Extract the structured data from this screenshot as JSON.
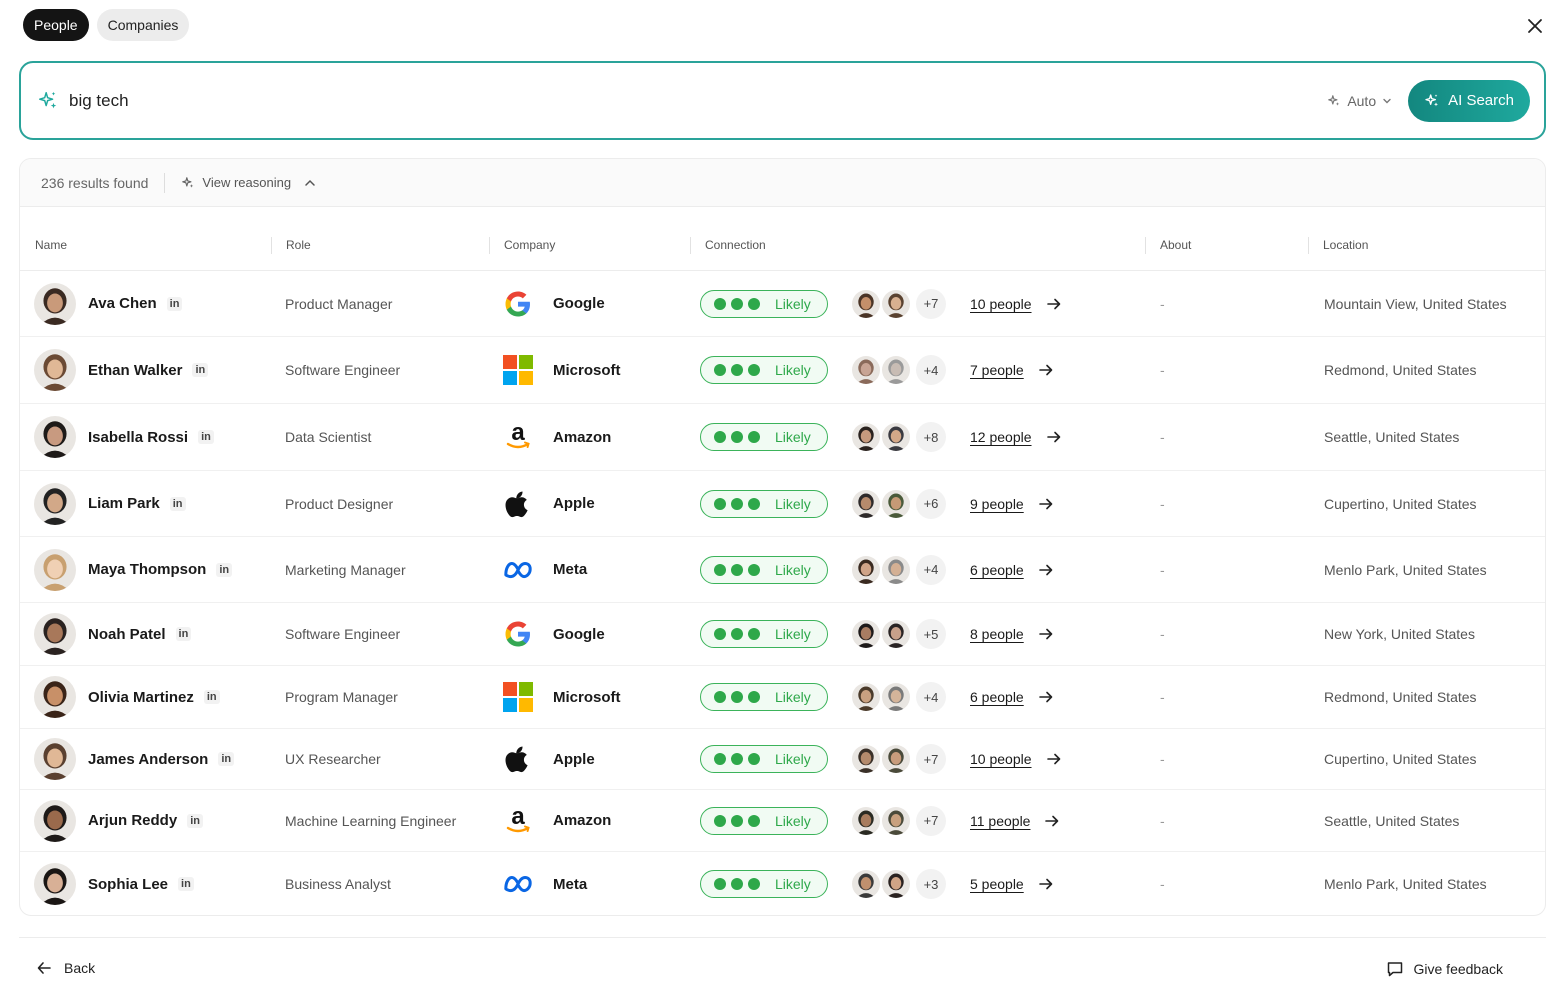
{
  "tabs": [
    {
      "label": "People",
      "active": true
    },
    {
      "label": "Companies",
      "active": false
    }
  ],
  "search": {
    "value": "big tech",
    "mode_label": "Auto",
    "button_label": "AI Search",
    "accent_color": "#2aa39a"
  },
  "results": {
    "count_label": "236 results found",
    "reasoning_label": "View reasoning"
  },
  "columns": [
    "Name",
    "Role",
    "Company",
    "Connection",
    "About",
    "Location"
  ],
  "rows": [
    {
      "name": "Ava Chen",
      "role": "Product Manager",
      "company": "Google",
      "logo": "google",
      "connection": "Likely",
      "plus": "+7",
      "people": "10 people",
      "about": "-",
      "location": "Mountain View, United States",
      "av": [
        "#3a2a22",
        "#c99a7a"
      ],
      "m1": [
        "#4a3426",
        "#c48f6a"
      ],
      "m2": [
        "#5a4230",
        "#d8b090"
      ]
    },
    {
      "name": "Ethan Walker",
      "role": "Software Engineer",
      "company": "Microsoft",
      "logo": "microsoft",
      "connection": "Likely",
      "plus": "+4",
      "people": "7 people",
      "about": "-",
      "location": "Redmond, United States",
      "av": [
        "#6b4a34",
        "#e0b896"
      ],
      "m1": [
        "#8a6a5a",
        "#c8a494"
      ],
      "m2": [
        "#9a9a9a",
        "#c8bcb4"
      ]
    },
    {
      "name": "Isabella Rossi",
      "role": "Data Scientist",
      "company": "Amazon",
      "logo": "amazon",
      "connection": "Likely",
      "plus": "+8",
      "people": "12 people",
      "about": "-",
      "location": "Seattle, United States",
      "av": [
        "#1e1a18",
        "#c89a80"
      ],
      "m1": [
        "#2a221e",
        "#c69a7e"
      ],
      "m2": [
        "#3a3a40",
        "#d4a888"
      ]
    },
    {
      "name": "Liam Park",
      "role": "Product Designer",
      "company": "Apple",
      "logo": "apple",
      "connection": "Likely",
      "plus": "+6",
      "people": "9 people",
      "about": "-",
      "location": "Cupertino, United States",
      "av": [
        "#222",
        "#d2a888"
      ],
      "m1": [
        "#2e2a2a",
        "#b68a6c"
      ],
      "m2": [
        "#4a5a3a",
        "#c69a76"
      ]
    },
    {
      "name": "Maya Thompson",
      "role": "Marketing Manager",
      "company": "Meta",
      "logo": "meta",
      "connection": "Likely",
      "plus": "+4",
      "people": "6 people",
      "about": "-",
      "location": "Menlo Park, United States",
      "av": [
        "#c8a070",
        "#f0d0b4"
      ],
      "m1": [
        "#3a2a20",
        "#d0a488"
      ],
      "m2": [
        "#8a8a8a",
        "#d4b094"
      ]
    },
    {
      "name": "Noah Patel",
      "role": "Software Engineer",
      "company": "Google",
      "logo": "google",
      "connection": "Likely",
      "plus": "+5",
      "people": "8 people",
      "about": "-",
      "location": "New York, United States",
      "av": [
        "#2a2220",
        "#a8785a"
      ],
      "m1": [
        "#1e1a1a",
        "#a87c62"
      ],
      "m2": [
        "#2a2424",
        "#c8a08a"
      ]
    },
    {
      "name": "Olivia Martinez",
      "role": "Program Manager",
      "company": "Microsoft",
      "logo": "microsoft",
      "connection": "Likely",
      "plus": "+4",
      "people": "6 people",
      "about": "-",
      "location": "Redmond, United States",
      "av": [
        "#3a2418",
        "#c89068"
      ],
      "m1": [
        "#4a3a2a",
        "#c8a080"
      ],
      "m2": [
        "#7a7a7a",
        "#d4b49a"
      ]
    },
    {
      "name": "James Anderson",
      "role": "UX Researcher",
      "company": "Apple",
      "logo": "apple",
      "connection": "Likely",
      "plus": "+7",
      "people": "10 people",
      "about": "-",
      "location": "Cupertino, United States",
      "av": [
        "#5a4030",
        "#e0b896"
      ],
      "m1": [
        "#3a3028",
        "#b48a6c"
      ],
      "m2": [
        "#4a4a3a",
        "#c89c7c"
      ]
    },
    {
      "name": "Arjun Reddy",
      "role": "Machine Learning Engineer",
      "company": "Amazon",
      "logo": "amazon",
      "connection": "Likely",
      "plus": "+7",
      "people": "11 people",
      "about": "-",
      "location": "Seattle, United States",
      "av": [
        "#1e1a18",
        "#9a6a4c"
      ],
      "m1": [
        "#2a2a22",
        "#a87c5e"
      ],
      "m2": [
        "#4a4a3a",
        "#c8a07e"
      ]
    },
    {
      "name": "Sophia Lee",
      "role": "Business Analyst",
      "company": "Meta",
      "logo": "meta",
      "connection": "Likely",
      "plus": "+3",
      "people": "5 people",
      "about": "-",
      "location": "Menlo Park, United States",
      "av": [
        "#1a1614",
        "#d8b096"
      ],
      "m1": [
        "#3a3a3a",
        "#c0906e"
      ],
      "m2": [
        "#2a2220",
        "#d0a486"
      ]
    }
  ],
  "footer": {
    "back_label": "Back",
    "feedback_label": "Give feedback"
  }
}
